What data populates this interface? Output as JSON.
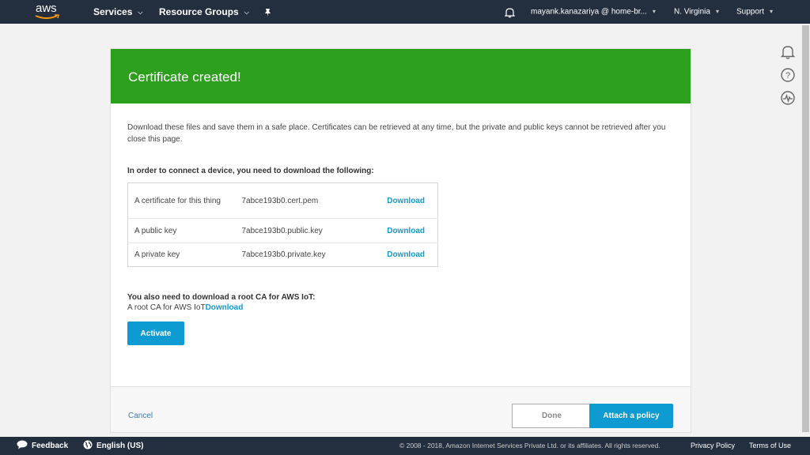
{
  "topnav": {
    "logo_text": "aws",
    "services_label": "Services",
    "resource_groups_label": "Resource Groups",
    "account_label": "mayank.kanazariya @ home-br...",
    "region_label": "N. Virginia",
    "support_label": "Support"
  },
  "side_icons": [
    "bell-icon",
    "help-icon",
    "health-icon"
  ],
  "card": {
    "header_title": "Certificate created!",
    "intro_text": "Download these files and save them in a safe place. Certificates can be retrieved at any time, but the private and public keys cannot be retrieved after you close this page.",
    "files_label": "In order to connect a device, you need to download the following:",
    "files": [
      {
        "description": "A certificate for this thing",
        "filename": "7abce193b0.cert.pem",
        "action": "Download"
      },
      {
        "description": "A public key",
        "filename": "7abce193b0.public.key",
        "action": "Download"
      },
      {
        "description": "A private key",
        "filename": "7abce193b0.private.key",
        "action": "Download"
      }
    ],
    "root_ca_label": "You also need to download a root CA for AWS IoT:",
    "root_ca_text": "A root CA for AWS IoT",
    "root_ca_link": "Download",
    "activate_label": "Activate"
  },
  "footer_actions": {
    "cancel_label": "Cancel",
    "done_label": "Done",
    "attach_label": "Attach a policy"
  },
  "footbar": {
    "feedback_label": "Feedback",
    "language_label": "English (US)",
    "copyright": "© 2008 - 2018, Amazon Internet Services Private Ltd. or its affiliates. All rights reserved.",
    "privacy_label": "Privacy Policy",
    "terms_label": "Terms of Use"
  },
  "colors": {
    "nav_bg": "#232f3e",
    "success_green": "#2ca01c",
    "primary_blue": "#0e9bd1"
  }
}
